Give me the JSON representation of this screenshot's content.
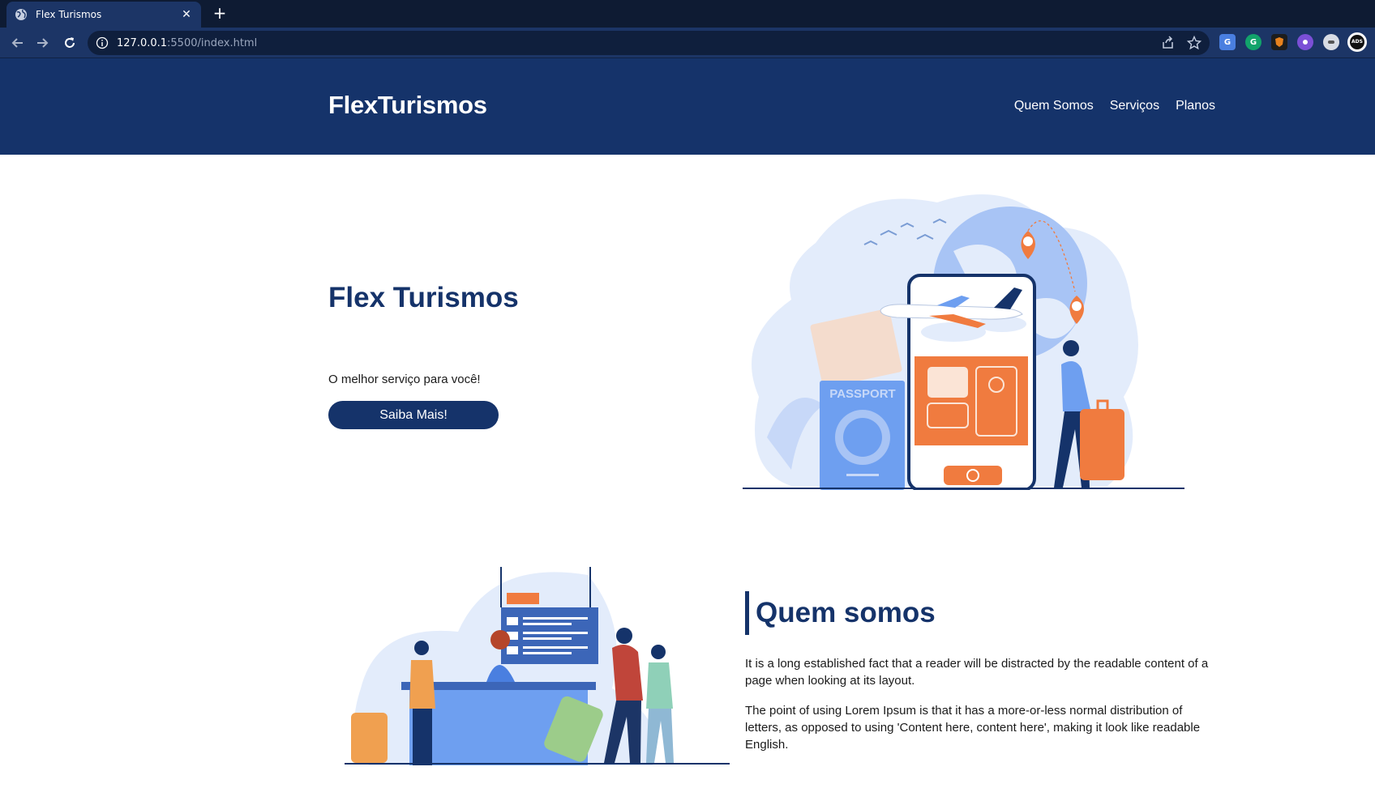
{
  "browser": {
    "tab_title": "Flex Turismos",
    "close_glyph": "✕",
    "new_tab_glyph": "+",
    "url_host": "127.0.0.1",
    "url_path": ":5500/index.html",
    "extensions": [
      "translate-icon",
      "grammarly-icon",
      "metamask-icon",
      "extension-purple-icon",
      "extension-grey-icon"
    ],
    "profile_label": "ADS"
  },
  "site": {
    "logo": "FlexTurismos",
    "nav": [
      "Quem Somos",
      "Serviços",
      "Planos"
    ]
  },
  "hero": {
    "title": "Flex Turismos",
    "subtitle": "O melhor serviço para você!",
    "cta": "Saiba Mais!",
    "passport_label": "PASSPORT"
  },
  "about": {
    "heading": "Quem somos",
    "paragraphs": [
      "It is a long established fact that a reader will be distracted by the readable content of a page when looking at its layout.",
      "The point of using Lorem Ipsum is that it has a more-or-less normal distribution of letters, as opposed to using 'Content here, content here', making it look like readable English."
    ]
  },
  "colors": {
    "brand_navy": "#15336a",
    "accent_orange": "#f07b3f",
    "illustration_blue": "#6e9ff0",
    "illustration_light": "#e3ecfb"
  }
}
